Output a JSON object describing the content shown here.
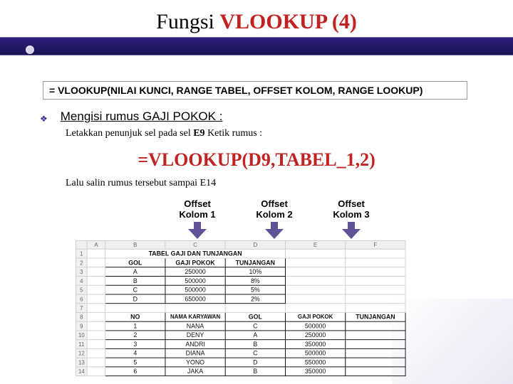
{
  "title": {
    "part1": "Fungsi ",
    "part2": "VLOOKUP (4)"
  },
  "syntax": "= VLOOKUP(NILAI KUNCI, RANGE TABEL, OFFSET KOLOM, RANGE LOOKUP)",
  "heading": "Mengisi rumus GAJI POKOK :",
  "instruction": {
    "pre": "Letakkan penunjuk sel pada sel ",
    "cell": "E9",
    "post": " Ketik rumus :"
  },
  "formula": "=VLOOKUP(D9,TABEL_1,2)",
  "copy_note": "Lalu salin rumus tersebut sampai E14",
  "offsets": [
    {
      "l1": "Offset",
      "l2": "Kolom 1"
    },
    {
      "l1": "Offset",
      "l2": "Kolom 2"
    },
    {
      "l1": "Offset",
      "l2": "Kolom 3"
    }
  ],
  "spreadsheet": {
    "col_letters": [
      "A",
      "B",
      "C",
      "D",
      "E",
      "F"
    ],
    "row_numbers": [
      "1",
      "2",
      "3",
      "4",
      "5",
      "6",
      "7",
      "8",
      "9",
      "10",
      "11",
      "12",
      "13",
      "14"
    ],
    "title_row": "TABEL GAJI DAN TUNJANGAN",
    "table1_header": [
      "GOL",
      "GAJI POKOK",
      "TUNJANGAN"
    ],
    "table1_rows": [
      [
        "A",
        "250000",
        "10%"
      ],
      [
        "B",
        "500000",
        "8%"
      ],
      [
        "C",
        "500000",
        "5%"
      ],
      [
        "D",
        "650000",
        "2%"
      ]
    ],
    "table2_header": [
      "NO",
      "NAMA KARYAWAN",
      "GOL",
      "GAJI POKOK",
      "TUNJANGAN"
    ],
    "table2_rows": [
      [
        "1",
        "NANA",
        "C",
        "500000",
        ""
      ],
      [
        "2",
        "DENY",
        "A",
        "250000",
        ""
      ],
      [
        "3",
        "ANDRI",
        "B",
        "350000",
        ""
      ],
      [
        "4",
        "DIANA",
        "C",
        "500000",
        ""
      ],
      [
        "5",
        "YONO",
        "D",
        "550000",
        ""
      ],
      [
        "6",
        "JAKA",
        "B",
        "350000",
        ""
      ]
    ]
  }
}
